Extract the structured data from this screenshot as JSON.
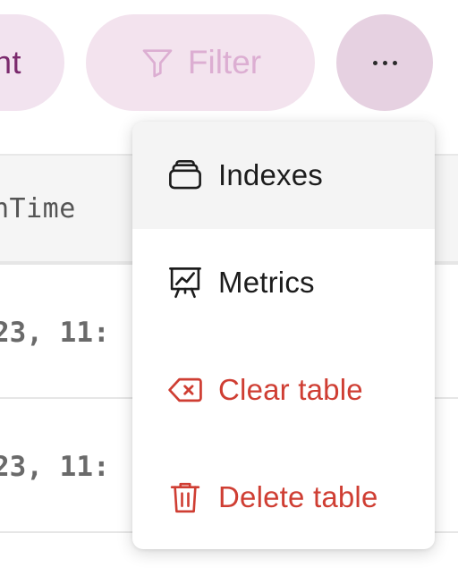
{
  "toolbar": {
    "left_button_label": "nt",
    "filter_label": "Filter",
    "filter_icon": "filter-icon",
    "more_icon": "more-horizontal-icon"
  },
  "table": {
    "header": "nTime",
    "rows": [
      {
        "time": "23, 11:"
      },
      {
        "time": "23, 11:"
      }
    ]
  },
  "menu": {
    "items": [
      {
        "label": "Indexes",
        "icon": "indexes-icon",
        "danger": false
      },
      {
        "label": "Metrics",
        "icon": "metrics-icon",
        "danger": false
      },
      {
        "label": "Clear table",
        "icon": "clear-icon",
        "danger": true
      },
      {
        "label": "Delete table",
        "icon": "trash-icon",
        "danger": true
      }
    ]
  },
  "colors": {
    "accent": "#7b2a6d",
    "pill_bg": "#f3e3ee",
    "more_bg": "#e6d1e1",
    "danger": "#cf3e33",
    "menu_hover": "#f4f4f4"
  }
}
